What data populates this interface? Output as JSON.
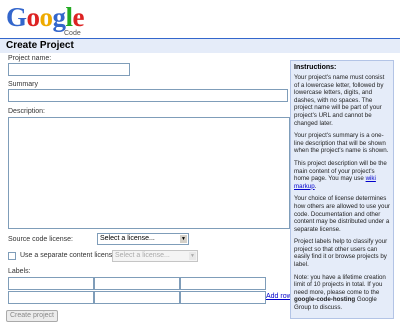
{
  "header": {
    "logo_letters": [
      {
        "ch": "G",
        "color": "#3366cc"
      },
      {
        "ch": "o",
        "color": "#dd2222"
      },
      {
        "ch": "o",
        "color": "#eeaa00"
      },
      {
        "ch": "g",
        "color": "#3366cc"
      },
      {
        "ch": "l",
        "color": "#22aa22"
      },
      {
        "ch": "e",
        "color": "#dd2222"
      }
    ],
    "logo_sub": "Code",
    "page_title": "Create Project"
  },
  "form": {
    "project_name_label": "Project name:",
    "summary_label": "Summary",
    "description_label": "Description:",
    "source_license_label": "Source code license:",
    "source_license_value": "Select a license...",
    "content_license_label": "Use a separate content license:",
    "content_license_value": "Select a license...",
    "labels_label": "Labels:",
    "add_row_link": "Add row",
    "create_button": "Create project"
  },
  "instructions": {
    "title": "Instructions:",
    "p1": "Your project's name must consist of a lowercase letter, followed by lowercase letters, digits, and dashes, with no spaces. The project name will be part of your project's URL and cannot be changed later.",
    "p2": "Your project's summary is a one-line description that will be shown when the project's name is shown.",
    "p3_text": "This project description will be the main content of your project's home page. You may use",
    "p3_link": "wiki markup",
    "p3_end": ".",
    "p4": "Your choice of license determines how others are allowed to use your code. Documentation and other content may be distributed under a separate license.",
    "p5": "Project labels help to classify your project so that other users can easily find it or browse projects by label.",
    "p6_text": "Note: you have a lifetime creation limit of 10 projects in total. If you need more, please come to the",
    "p6_bold": "google-code-hosting",
    "p6_end": "Google Group to discuss."
  },
  "colors": {
    "accent": "#3366cc",
    "panel_bg": "#e5ecf9",
    "link": "#0000cc"
  }
}
